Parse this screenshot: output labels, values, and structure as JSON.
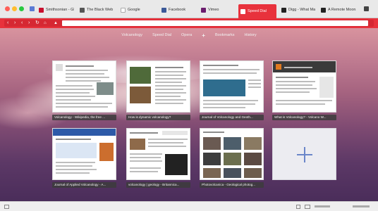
{
  "browser": {
    "colors": {
      "accent": "#e8323c",
      "tab_bar": "#e9e9e9"
    },
    "tabs": [
      {
        "label": "Smithsonian - Global Vo...",
        "favicon_color": "#c8102e",
        "icon": "smithsonian-favicon-icon"
      },
      {
        "label": "The Black Web",
        "favicon_color": "#555555",
        "icon": "black-web-favicon-icon"
      },
      {
        "label": "Google",
        "favicon_color": "#ffffff",
        "icon": "google-favicon-icon"
      },
      {
        "label": "Facebook",
        "favicon_color": "#3b5998",
        "icon": "facebook-favicon-icon"
      },
      {
        "label": "Vimeo",
        "favicon_color": "#6b1d6e",
        "icon": "vimeo-favicon-icon"
      },
      {
        "label": "Speed Dial",
        "favicon_color": "#ffffff",
        "icon": "speed-dial-favicon-icon",
        "active": true
      },
      {
        "label": "Digg - What Matters",
        "favicon_color": "#222222",
        "icon": "digg-favicon-icon"
      },
      {
        "label": "A Remote Moon...",
        "favicon_color": "#222222",
        "icon": "moon-favicon-icon"
      }
    ],
    "address": {
      "value": "",
      "placeholder": ""
    }
  },
  "speed_dial": {
    "nav": [
      {
        "label": "Volcanology"
      },
      {
        "label": "Speed Dial"
      },
      {
        "label": "Opera"
      },
      {
        "label": "+"
      },
      {
        "label": "Bookmarks"
      },
      {
        "label": "History"
      }
    ],
    "tiles": [
      {
        "caption": "Volcanology - Wikipedia, the free ..."
      },
      {
        "caption": "How is dynamic volcanology?"
      },
      {
        "caption": "Journal of Volcanology and Geoth..."
      },
      {
        "caption": "What is Volcanology? - Volcano W..."
      },
      {
        "caption": "Journal of Applied Volcanology - A..."
      },
      {
        "caption": "volcanology | geology - Britannica..."
      },
      {
        "caption": "Photovolcanica - Geological photog..."
      }
    ],
    "add_tile": {
      "icon": "add-plus-icon"
    }
  }
}
